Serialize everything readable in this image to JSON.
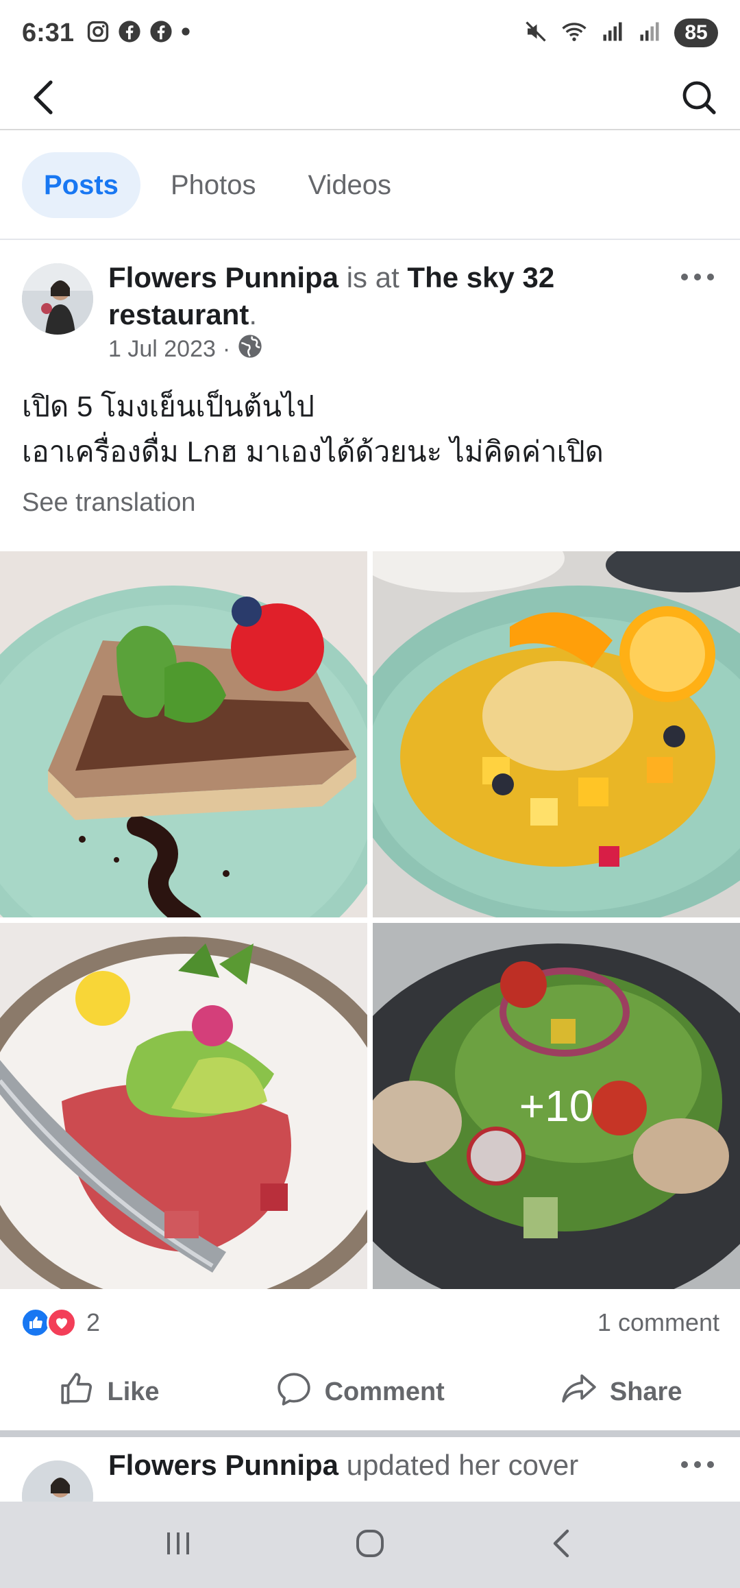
{
  "status_bar": {
    "time": "6:31",
    "battery": "85",
    "icons_left": [
      "instagram-icon",
      "facebook-icon",
      "facebook-icon",
      "dot-icon"
    ],
    "icons_right": [
      "mute-icon",
      "wifi-icon",
      "signal-icon",
      "signal-icon"
    ]
  },
  "header": {
    "back_icon": "back-arrow-icon",
    "search_icon": "search-icon"
  },
  "tabs": [
    {
      "label": "Posts",
      "active": true
    },
    {
      "label": "Photos",
      "active": false
    },
    {
      "label": "Videos",
      "active": false
    }
  ],
  "post": {
    "author": "Flowers Punnipa",
    "connector": " is at ",
    "place": "The sky 32 restaurant",
    "trailing": ".",
    "date": "1 Jul 2023",
    "separator": "·",
    "privacy_icon": "globe-icon",
    "text_line1": "เปิด 5 โมงเย็นเป็นต้นไป",
    "text_line2": "เอาเครื่องดื่ม Lกฮ มาเองได้ด้วยนะ ไม่คิดค่าเปิด",
    "see_translation": "See translation",
    "more_photos": "+10",
    "reaction_count": "2",
    "comment_count": "1 comment",
    "actions": {
      "like": "Like",
      "comment": "Comment",
      "share": "Share"
    }
  },
  "next_post": {
    "author": "Flowers Punnipa",
    "action": " updated her cover"
  },
  "colors": {
    "accent": "#1877f2",
    "tab_active_bg": "#e7f0fb",
    "love": "#f33e58",
    "secondary_text": "#65676b"
  }
}
